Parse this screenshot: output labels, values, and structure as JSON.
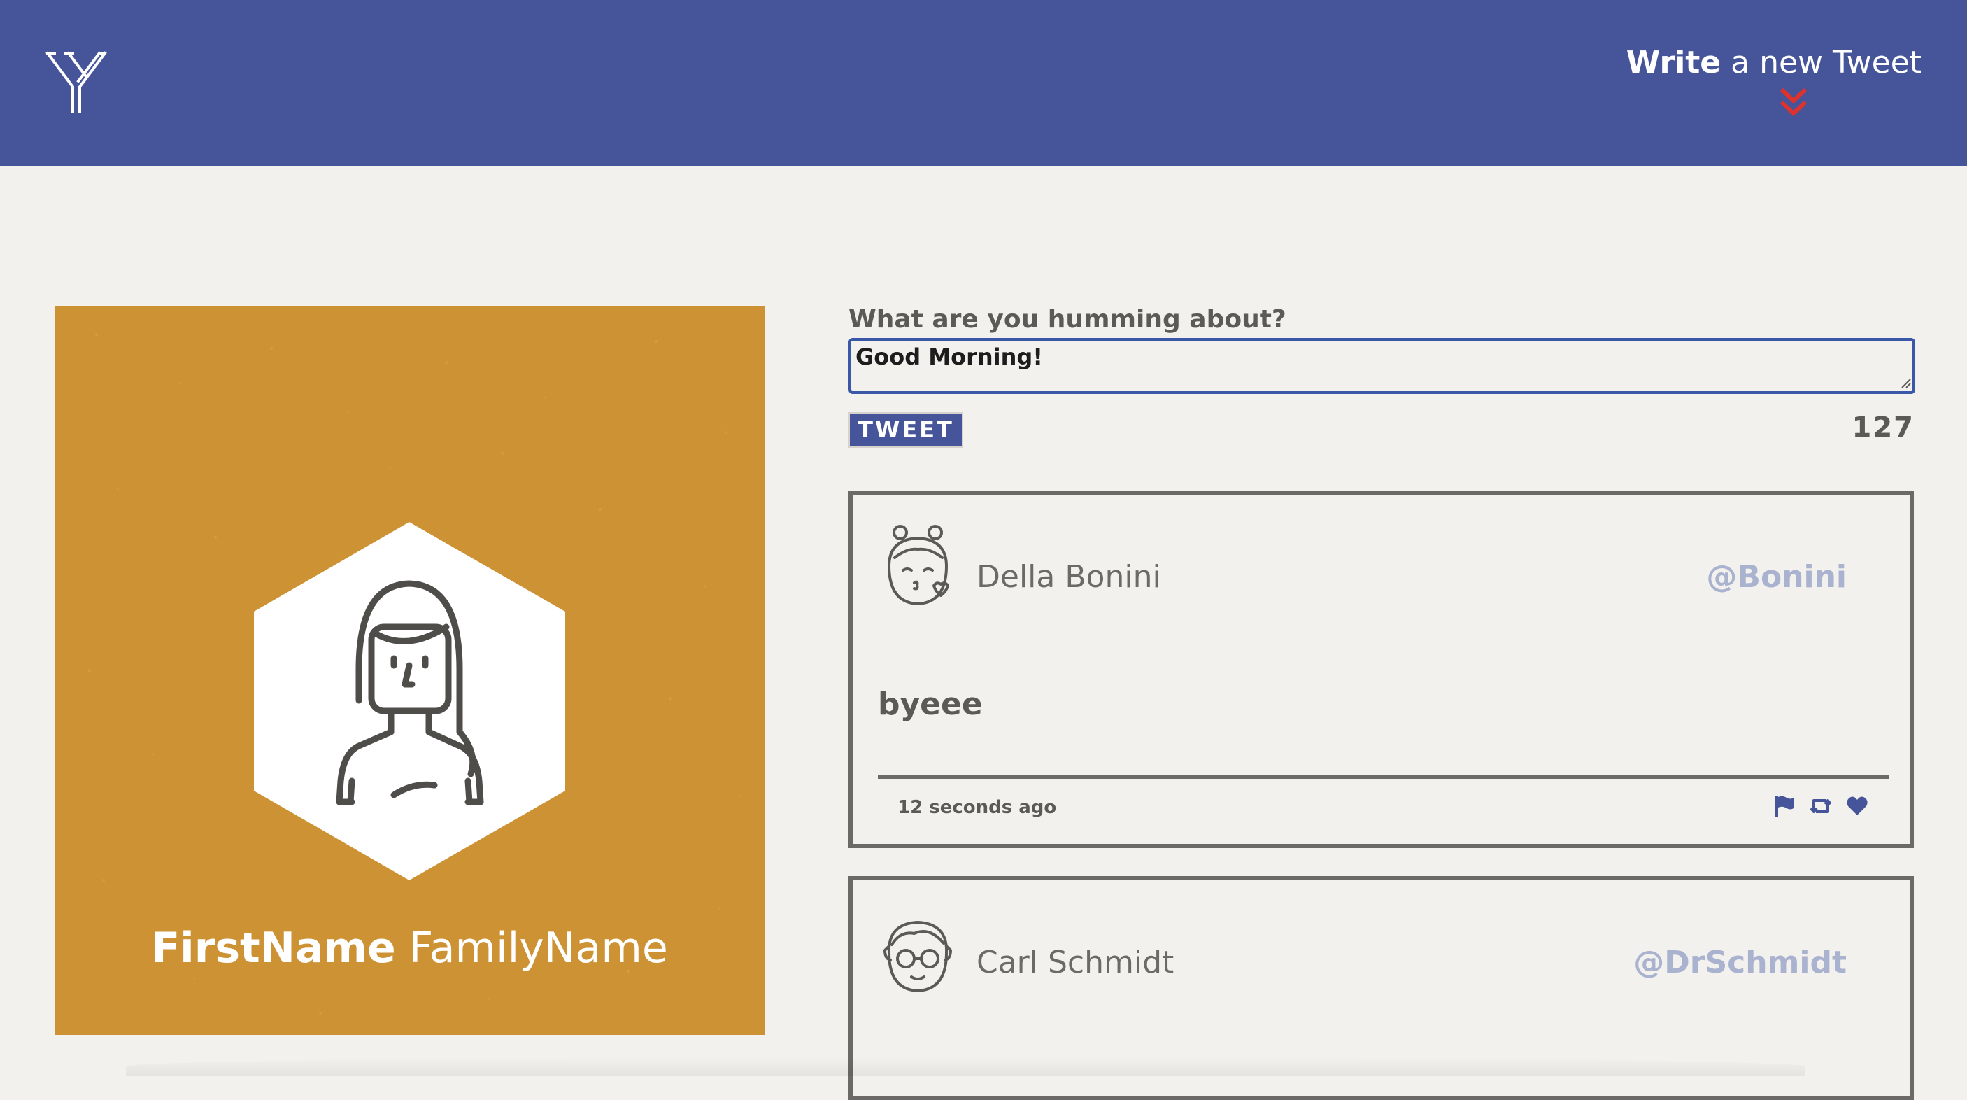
{
  "nav": {
    "logo_icon": "y-logo-icon",
    "write_link_strong": "Write",
    "write_link_rest": " a new Tweet",
    "chevron_icon": "double-chevron-down-icon",
    "colors": {
      "bar": "#465499",
      "chevron": "#e0322d"
    }
  },
  "profile": {
    "first_name": "FirstName",
    "family_name": "FamilyName",
    "avatar_icon": "woman-avatar-icon",
    "colors": {
      "card": "#cd9233"
    }
  },
  "composer": {
    "label": "What are you humming about?",
    "value": "Good Morning!",
    "submit_label": "TWEET",
    "char_count": "127"
  },
  "tweets": [
    {
      "avatar_icon": "girl-kiss-avatar-icon",
      "name": "Della Bonini",
      "handle": "@Bonini",
      "body": "byeee",
      "time": "12 seconds ago",
      "actions": [
        "flag-icon",
        "retweet-icon",
        "heart-icon"
      ]
    },
    {
      "avatar_icon": "man-glasses-avatar-icon",
      "name": "Carl Schmidt",
      "handle": "@DrSchmidt"
    }
  ],
  "colors": {
    "page_bg": "#f3f1ed",
    "text_gray": "#5b5a57",
    "handle": "#a9b2cf",
    "action_icons": "#465499"
  }
}
